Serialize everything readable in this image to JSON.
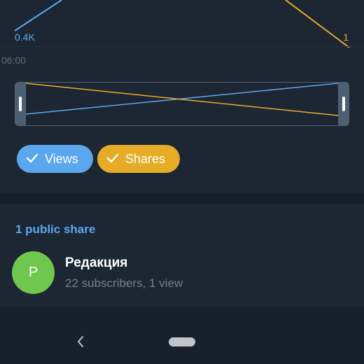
{
  "chart": {
    "views_label": "0.4K",
    "shares_label": "1",
    "time_label": "06:00",
    "colors": {
      "views": "#5aa7ee",
      "shares": "#e6ac27"
    }
  },
  "filters": [
    {
      "label": "Views",
      "checked": true,
      "color": "#5aa7ee"
    },
    {
      "label": "Shares",
      "checked": true,
      "color": "#e6ac27"
    }
  ],
  "public_shares": {
    "title": "1 public share",
    "items": [
      {
        "avatar_letter": "P",
        "name": "Редакция",
        "meta": "22 subscribers, 1 view",
        "avatar_color": "#6fc74d"
      }
    ]
  },
  "navigation": {
    "back_icon": "chevron-left-icon",
    "home_icon": "home-pill-icon"
  }
}
